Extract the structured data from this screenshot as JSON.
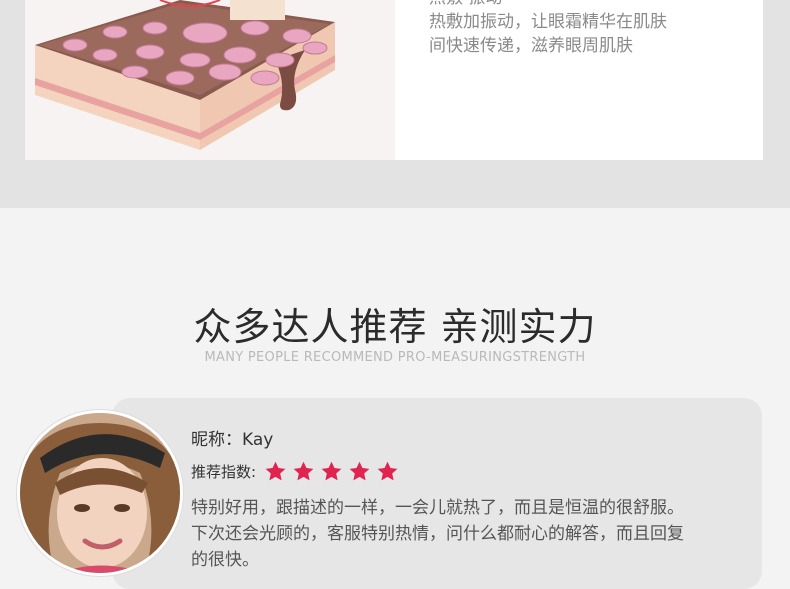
{
  "feature": {
    "lines": [
      "热敷·振动",
      "热敷加振动，让眼霜精华在肌肤",
      "间快速传递，滋养眼周肌肤"
    ]
  },
  "section": {
    "title": "众多达人推荐 亲测实力",
    "subtitle": "MANY PEOPLE RECOMMEND PRO-MEASURINGSTRENGTH"
  },
  "review": {
    "nickname": "昵称：Kay",
    "rating_label": "推荐指数:",
    "rating": 5,
    "rating_max": 5,
    "text_lines": [
      "特别好用，跟描述的一样，一会儿就热了，而且是恒温的很舒服。",
      "下次还会光顾的，客服特别热情，问什么都耐心的解答，而且回复",
      "的很快。"
    ]
  },
  "colors": {
    "star": "#e0234f",
    "card": "#e6e6e6",
    "band": "#e3e3e3"
  }
}
